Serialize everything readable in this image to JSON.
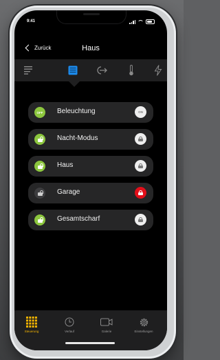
{
  "status": {
    "time": "9:41"
  },
  "nav": {
    "back_label": "Zurück",
    "title": "Haus"
  },
  "tabs": [
    {
      "name": "list-icon"
    },
    {
      "name": "control-panel-icon",
      "active": true
    },
    {
      "name": "exit-icon"
    },
    {
      "name": "thermometer-icon"
    },
    {
      "name": "lightning-icon"
    }
  ],
  "rows": [
    {
      "label": "Beleuchtung",
      "left": {
        "text": "OFF",
        "color": "#8cc63e"
      },
      "right": {
        "text": "ON",
        "color": "#eeeeee"
      }
    },
    {
      "label": "Nacht-Modus",
      "left": {
        "icon": "lock-open-icon",
        "color": "#8cc63e"
      },
      "right": {
        "icon": "lock-icon",
        "color": "#eeeeee"
      }
    },
    {
      "label": "Haus",
      "left": {
        "icon": "lock-open-icon",
        "color": "#8cc63e"
      },
      "right": {
        "icon": "lock-icon",
        "color": "#eeeeee"
      }
    },
    {
      "label": "Garage",
      "left": {
        "icon": "lock-open-icon",
        "color": "#3d3d3f"
      },
      "right": {
        "icon": "lock-icon",
        "color": "#e20f1a"
      }
    },
    {
      "label": "Gesamtscharf",
      "left": {
        "icon": "lock-open-icon",
        "color": "#8cc63e"
      },
      "right": {
        "icon": "lock-icon",
        "color": "#eeeeee"
      }
    }
  ],
  "bottom": {
    "items": [
      {
        "label": "Steuerung",
        "icon": "grid-icon",
        "active": true
      },
      {
        "label": "Verlauf",
        "icon": "clock-icon"
      },
      {
        "label": "Galerie",
        "icon": "camera-icon"
      },
      {
        "label": "Einstellungen",
        "icon": "gear-icon"
      }
    ]
  },
  "colors": {
    "accent": "#f4b400",
    "green": "#8cc63e",
    "alarm": "#e20f1a",
    "tab_active": "#1c8df0"
  }
}
